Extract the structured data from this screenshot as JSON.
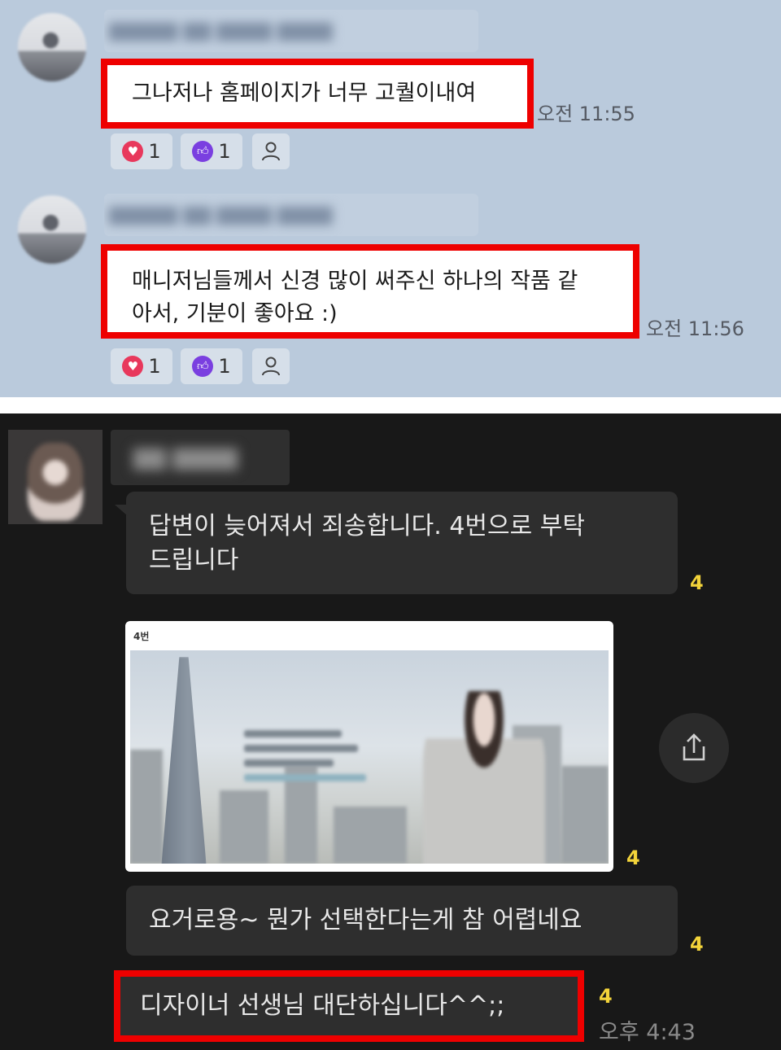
{
  "light_chat": {
    "messages": [
      {
        "text": "그나저나 홈페이지가 너무 고퀄이내여",
        "time": "오전 11:55",
        "reactions": {
          "heart": "1",
          "like": "1"
        }
      },
      {
        "text": "매니저님들께서 신경 많이 써주신 하나의 작품 같아서, 기분이 좋아요 :)",
        "line1": "매니저님들께서 신경 많이 써주신 하나의 작품 같",
        "line2": "아서, 기분이 좋아요 :)",
        "time": "오전 11:56",
        "reactions": {
          "heart": "1",
          "like": "1"
        }
      }
    ]
  },
  "dark_chat": {
    "messages": [
      {
        "line1": "답변이 늦어져서 죄송합니다. 4번으로 부탁",
        "line2": "드립니다",
        "unread": "4"
      },
      {
        "image_label": "4번",
        "unread": "4"
      },
      {
        "text": "요거로용~ 뭔가 선택한다는게 참 어렵네요",
        "unread": "4"
      },
      {
        "text": "디자이너 선생님 대단하십니다^^;;",
        "unread": "4",
        "time": "오후 4:43"
      }
    ]
  },
  "icons": {
    "heart": "heart-icon",
    "like": "thumbs-up-icon",
    "user": "user-icon",
    "share": "share-icon"
  },
  "colors": {
    "highlight": "#ee0000",
    "unread": "#f3d43a",
    "light_bg": "#bacadc",
    "dark_bg": "#181818"
  }
}
